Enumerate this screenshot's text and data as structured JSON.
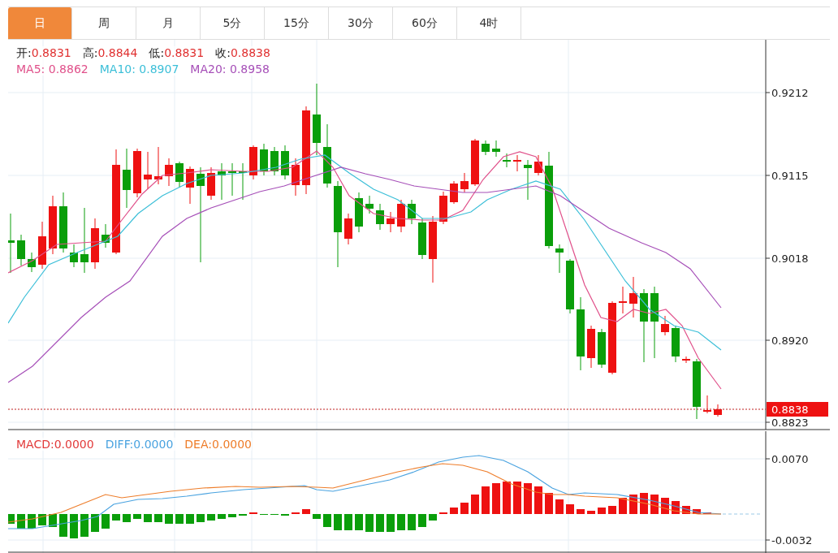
{
  "tabs": [
    {
      "label": "日",
      "selected": true
    },
    {
      "label": "周",
      "selected": false
    },
    {
      "label": "月",
      "selected": false
    },
    {
      "label": "5分",
      "selected": false
    },
    {
      "label": "15分",
      "selected": false
    },
    {
      "label": "30分",
      "selected": false
    },
    {
      "label": "60分",
      "selected": false
    },
    {
      "label": "4时",
      "selected": false
    }
  ],
  "quote": [
    {
      "label": "开:",
      "value": "0.8831"
    },
    {
      "label": "高:",
      "value": "0.8844"
    },
    {
      "label": "低:",
      "value": "0.8831"
    },
    {
      "label": "收:",
      "value": "0.8838"
    }
  ],
  "moving_averages": [
    {
      "label": "MA5:",
      "value": "0.8862",
      "color": "#e0508a"
    },
    {
      "label": "MA10:",
      "value": "0.8907",
      "color": "#3cbfd8"
    },
    {
      "label": "MA20:",
      "value": "0.8958",
      "color": "#a64fb8"
    }
  ],
  "price_axis": [
    "0.9212",
    "0.9115",
    "0.9018",
    "0.8920",
    "0.8823"
  ],
  "current_price": "0.8838",
  "macd_legend": [
    {
      "label": "MACD:",
      "value": "0.0000",
      "color": "#e23a3a"
    },
    {
      "label": "DIFF:",
      "value": "0.0000",
      "color": "#4aa3e0"
    },
    {
      "label": "DEA:",
      "value": "0.0000",
      "color": "#ee7d2a"
    }
  ],
  "macd_axis": [
    "0.0070",
    "-0.0032"
  ]
}
